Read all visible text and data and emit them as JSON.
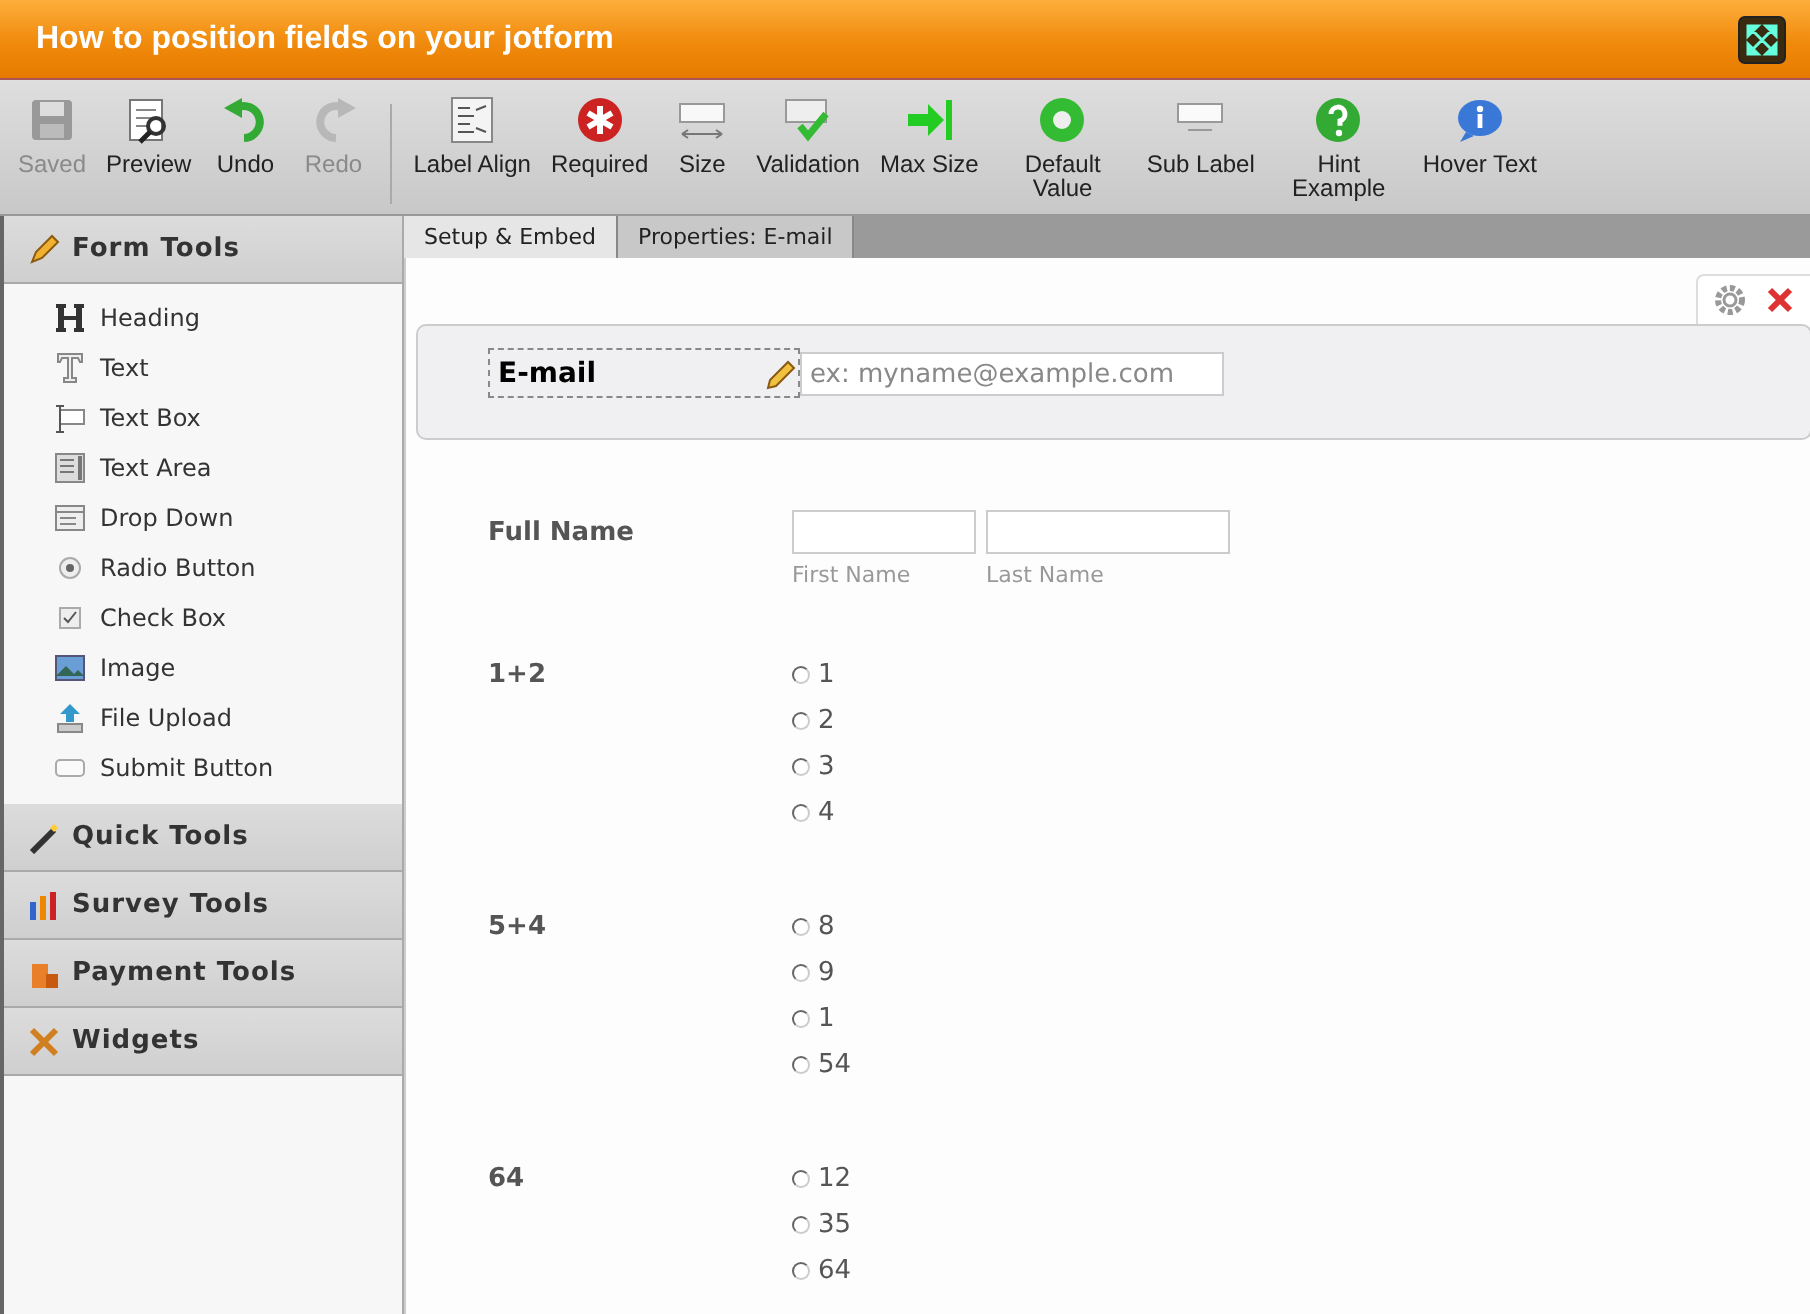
{
  "window": {
    "title": "How to position fields on your jotform"
  },
  "toolbar": [
    {
      "label": "Saved",
      "disabled": true
    },
    {
      "label": "Preview",
      "disabled": false
    },
    {
      "label": "Undo",
      "disabled": false
    },
    {
      "label": "Redo",
      "disabled": true
    },
    {
      "label": "Label Align",
      "disabled": false
    },
    {
      "label": "Required",
      "disabled": false
    },
    {
      "label": "Size",
      "disabled": false
    },
    {
      "label": "Validation",
      "disabled": false
    },
    {
      "label": "Max Size",
      "disabled": false
    },
    {
      "label": "Default Value",
      "disabled": false
    },
    {
      "label": "Sub Label",
      "disabled": false
    },
    {
      "label": "Hint Example",
      "disabled": false
    },
    {
      "label": "Hover Text",
      "disabled": false
    }
  ],
  "sidebar": [
    {
      "title": "Form Tools",
      "items": [
        "Heading",
        "Text",
        "Text Box",
        "Text Area",
        "Drop Down",
        "Radio Button",
        "Check Box",
        "Image",
        "File Upload",
        "Submit Button"
      ]
    },
    {
      "title": "Quick Tools"
    },
    {
      "title": "Survey Tools"
    },
    {
      "title": "Payment Tools"
    },
    {
      "title": "Widgets"
    }
  ],
  "tabs": [
    {
      "label": "Setup & Embed",
      "selected": true
    },
    {
      "label": "Properties: E-mail",
      "selected": false
    }
  ],
  "fields": [
    {
      "kind": "email",
      "label": "E-mail",
      "selected": true,
      "placeholder": "ex: myname@example.com"
    },
    {
      "kind": "fullname",
      "label": "Full Name",
      "selected": false,
      "sublabels": [
        "First Name",
        "Last Name"
      ]
    },
    {
      "kind": "radio",
      "label": "1+2",
      "selected": false,
      "options": [
        {
          "label": "1",
          "checked": false
        },
        {
          "label": "2",
          "checked": false
        },
        {
          "label": "3",
          "checked": false
        },
        {
          "label": "4",
          "checked": false
        }
      ]
    },
    {
      "kind": "radio",
      "label": "5+4",
      "selected": false,
      "options": [
        {
          "label": "8",
          "checked": false
        },
        {
          "label": "9",
          "checked": false
        },
        {
          "label": "1",
          "checked": false
        },
        {
          "label": "54",
          "checked": false
        }
      ]
    },
    {
      "kind": "radio",
      "label": "64",
      "selected": false,
      "options": [
        {
          "label": "12",
          "checked": false
        },
        {
          "label": "35",
          "checked": false
        },
        {
          "label": "64",
          "checked": false
        }
      ]
    }
  ]
}
